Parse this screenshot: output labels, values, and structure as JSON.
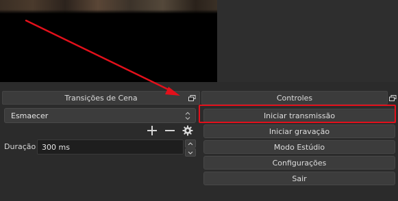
{
  "transitions": {
    "header": "Transições de Cena",
    "selected": "Esmaecer",
    "duration_label": "Duração",
    "duration_value": "300 ms"
  },
  "controls": {
    "header": "Controles",
    "buttons": [
      "Iniciar transmissão",
      "Iniciar gravação",
      "Modo Estúdio",
      "Configurações",
      "Sair"
    ]
  },
  "colors": {
    "highlight": "#e3101b",
    "arrow": "#e3101b"
  },
  "icons": {
    "dock_float": "window-restore-icon",
    "add": "plus-icon",
    "remove": "minus-icon",
    "settings": "gear-icon",
    "combo": "up-down-arrows-icon"
  }
}
